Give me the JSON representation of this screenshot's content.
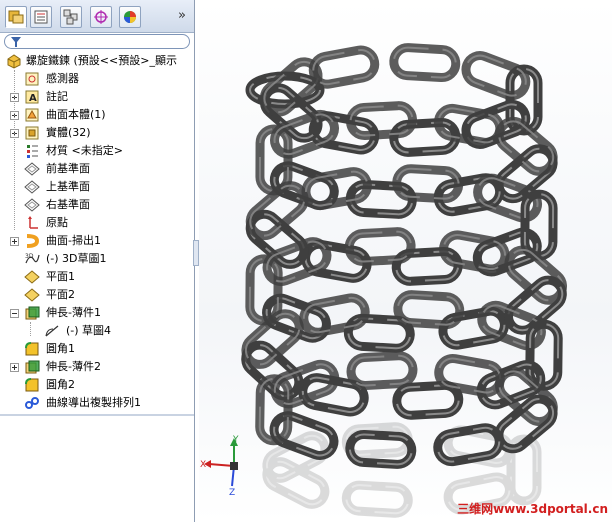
{
  "feature_tree": {
    "root_label": "螺旋鐵鍊 (預設<<預設>_顯示",
    "items": [
      {
        "label": "感測器",
        "icon": "sensor-icon",
        "expandable": false
      },
      {
        "label": "註記",
        "icon": "annotation-icon",
        "expandable": true
      },
      {
        "label": "曲面本體(1)",
        "icon": "surface-bodies-icon",
        "expandable": true
      },
      {
        "label": "實體(32)",
        "icon": "solid-bodies-icon",
        "expandable": true
      },
      {
        "label": "材質 <未指定>",
        "icon": "material-icon",
        "expandable": false
      },
      {
        "label": "前基準面",
        "icon": "plane-icon",
        "expandable": false
      },
      {
        "label": "上基準面",
        "icon": "plane-icon",
        "expandable": false
      },
      {
        "label": "右基準面",
        "icon": "plane-icon",
        "expandable": false
      },
      {
        "label": "原點",
        "icon": "origin-icon",
        "expandable": false
      },
      {
        "label": "曲面-掃出1",
        "icon": "surface-sweep-icon",
        "expandable": true
      },
      {
        "label": "(-) 3D草圖1",
        "icon": "3d-sketch-icon",
        "expandable": false
      },
      {
        "label": "平面1",
        "icon": "plane-feature-icon",
        "expandable": false
      },
      {
        "label": "平面2",
        "icon": "plane-feature-icon",
        "expandable": false
      },
      {
        "label": "伸長-薄件1",
        "icon": "extrude-thin-icon",
        "expandable": true,
        "expanded": true
      },
      {
        "label": "(-) 草圖4",
        "icon": "sketch-icon",
        "expandable": false,
        "child": true
      },
      {
        "label": "圓角1",
        "icon": "fillet-icon",
        "expandable": false
      },
      {
        "label": "伸長-薄件2",
        "icon": "extrude-thin-icon",
        "expandable": true
      },
      {
        "label": "圓角2",
        "icon": "fillet-icon",
        "expandable": false
      },
      {
        "label": "曲線導出複製排列1",
        "icon": "curve-pattern-icon",
        "expandable": false
      }
    ]
  },
  "tabs": [
    {
      "name": "featuremanager-tab",
      "icon": "feature-tree-icon"
    },
    {
      "name": "propertymanager-tab",
      "icon": "property-icon"
    },
    {
      "name": "configurationmanager-tab",
      "icon": "configuration-icon"
    },
    {
      "name": "dimxpert-tab",
      "icon": "crosshair-icon"
    },
    {
      "name": "display-manager-tab",
      "icon": "appearance-icon"
    }
  ],
  "triad": {
    "x": "X",
    "y": "Y",
    "z": "Z"
  },
  "watermark": "三维网www.3dportal.cn",
  "colors": {
    "chain": "#3f3f3f",
    "chain_highlight": "#8a8a8a",
    "panel_bg": "#ffffff",
    "accent": "#3a63a8"
  }
}
